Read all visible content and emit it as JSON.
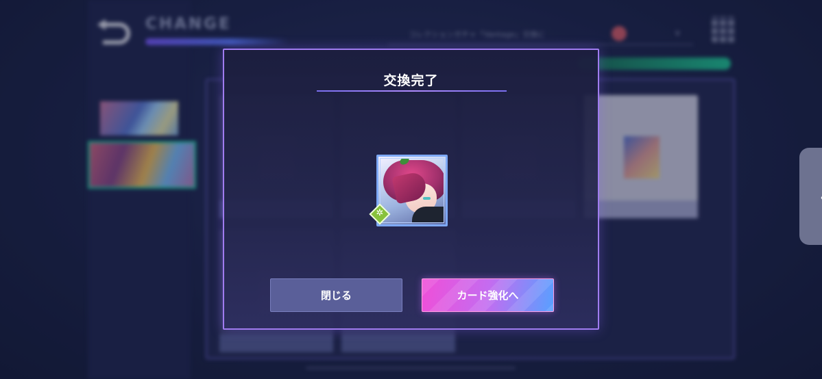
{
  "background": {
    "header_title": "CHANGE",
    "search_text": "コレクションガチャ「Vantage」交換に",
    "search_caret": "∨",
    "side_tab_chevron": "〈"
  },
  "modal": {
    "title": "交換完了",
    "close_button_label": "閉じる",
    "enhance_button_label": "カード強化へ",
    "card_badge_symbol": "✲"
  },
  "colors": {
    "modal_border": "#a07cf0",
    "close_button": "#5a5f99",
    "enhance_gradient_start": "#ef4fd8",
    "enhance_gradient_end": "#58a0ff",
    "accent_green": "#22c89a",
    "badge_green": "#88c23c"
  },
  "icons": {
    "back": "back-arrow-icon",
    "menu": "grid-menu-icon",
    "side_tab": "chevron-left-icon",
    "badge": "attribute-badge-icon"
  }
}
